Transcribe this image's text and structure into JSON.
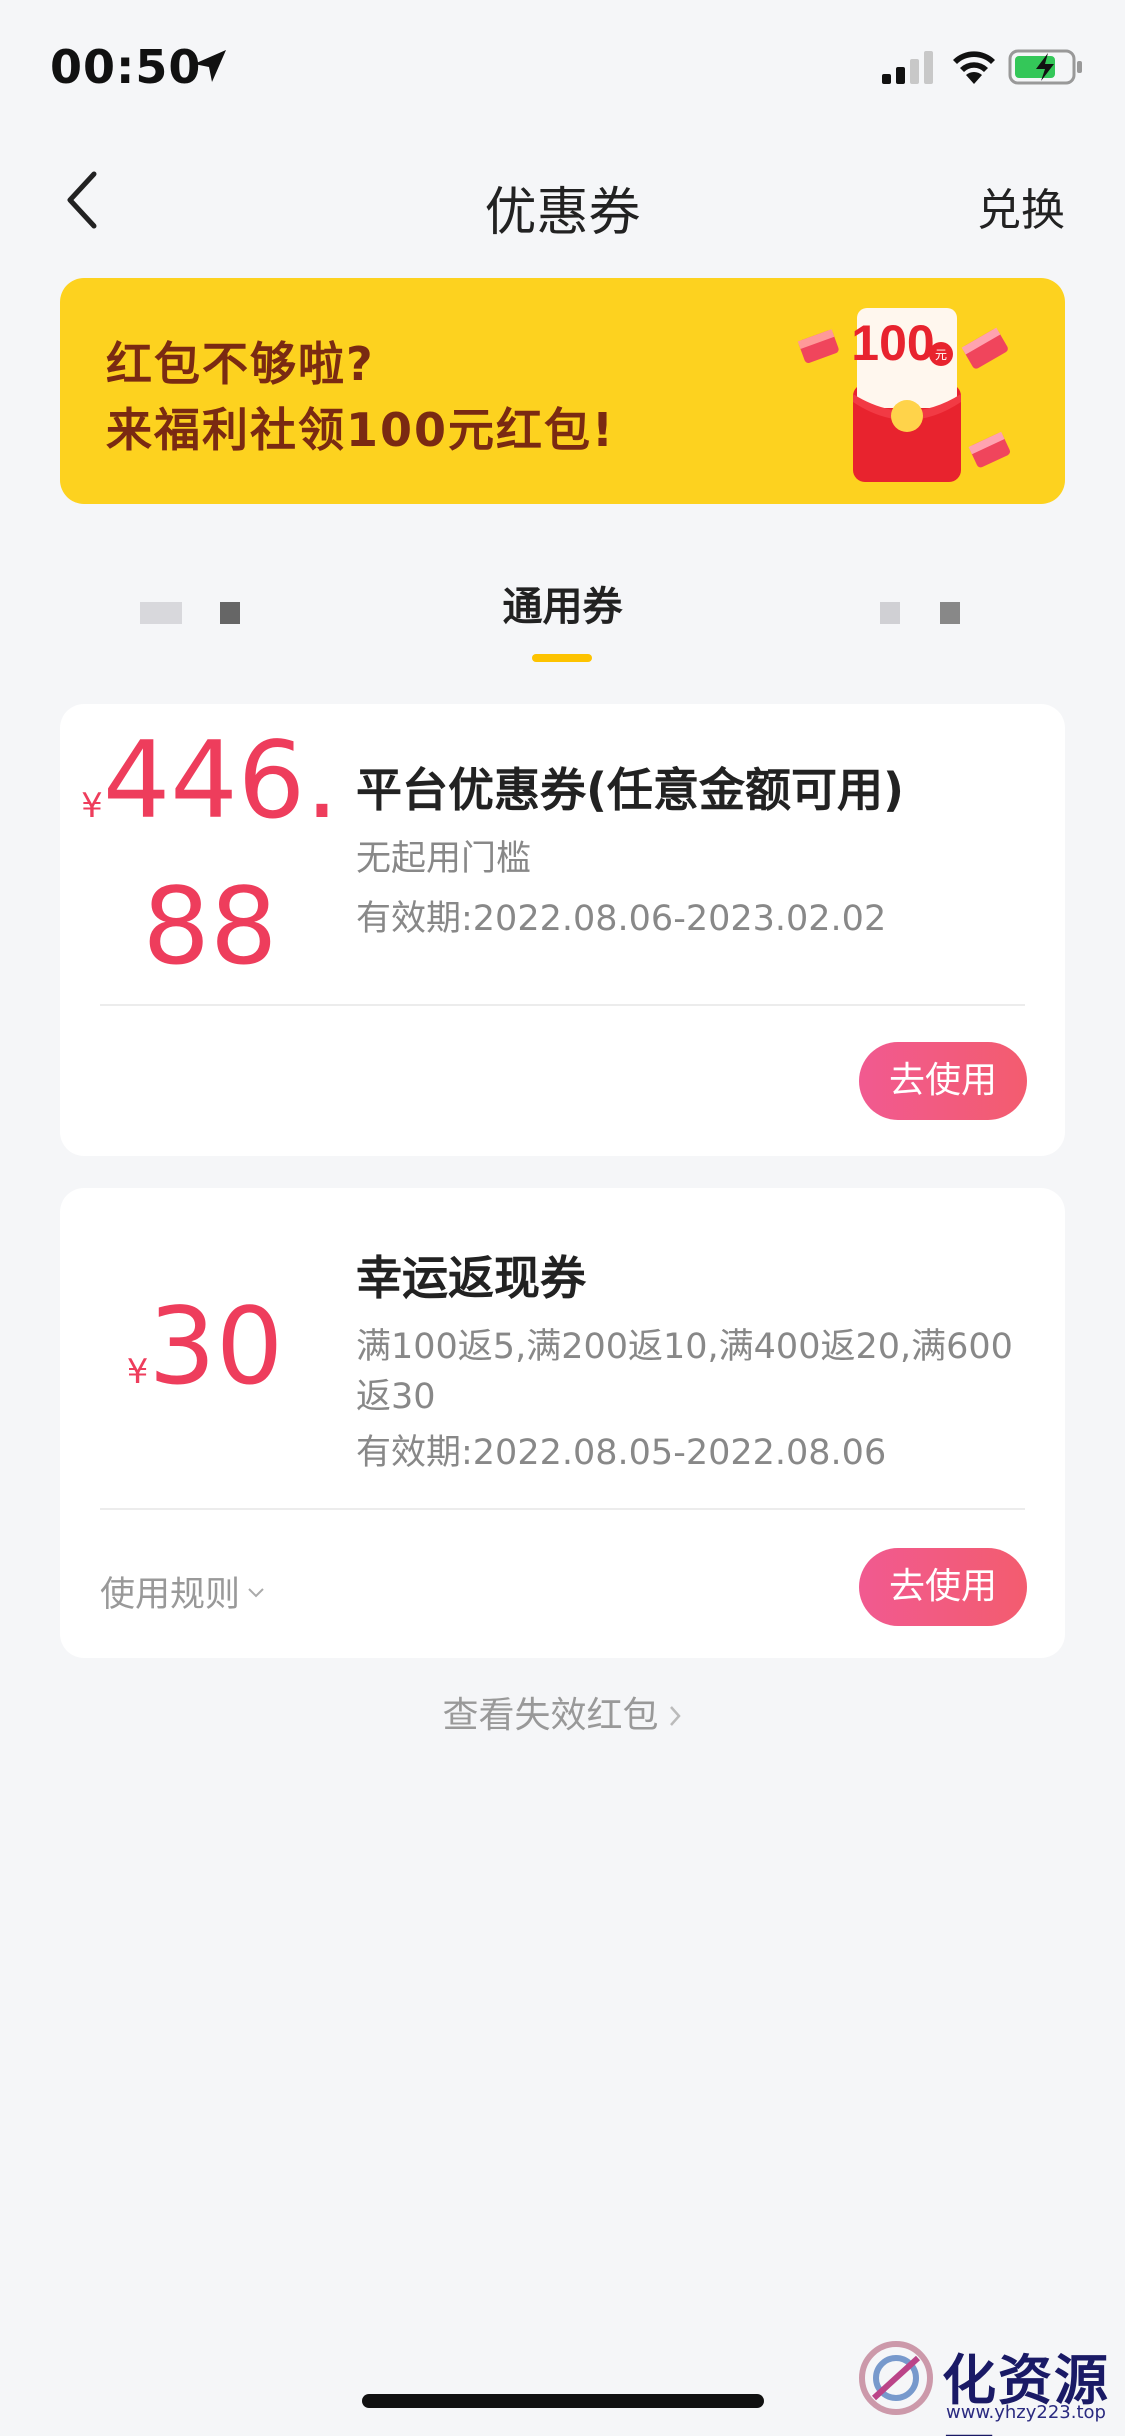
{
  "status_bar": {
    "time": "00:50"
  },
  "nav": {
    "title": "优惠券",
    "exchange_label": "兑换"
  },
  "banner": {
    "line1": "红包不够啦?",
    "line2": "来福利社领100元红包!",
    "hongbao_amount": "100",
    "hongbao_unit": "元"
  },
  "tabs": {
    "active_label": "通用券"
  },
  "coupons": [
    {
      "currency": "¥",
      "amount_line1": "446.",
      "amount_line2": "88",
      "title": "平台优惠券(任意金额可用)",
      "description": "无起用门槛",
      "validity": "有效期:2022.08.06-2023.02.02",
      "use_label": "去使用"
    },
    {
      "currency": "¥",
      "amount": "30",
      "title": "幸运返现券",
      "description": "满100返5,满200返10,满400返20,满600返30",
      "validity": "有效期:2022.08.05-2022.08.06",
      "rules_label": "使用规则",
      "use_label": "去使用"
    }
  ],
  "expired_link": "查看失效红包",
  "watermark": {
    "text": "化资源网",
    "url": "www.yhzy223.top"
  },
  "colors": {
    "accent_red": "#ee3d5c",
    "button_gradient_start": "#f15a90",
    "button_gradient_end": "#f35c6f",
    "banner_yellow": "#fdd21f",
    "tab_underline": "#fdc300",
    "background": "#f5f6f8"
  },
  "icons": [
    "location-arrow-icon",
    "signal-icon",
    "wifi-icon",
    "battery-charging-icon",
    "back-chevron-icon",
    "chevron-down-icon",
    "chevron-right-icon",
    "red-envelope-icon"
  ]
}
